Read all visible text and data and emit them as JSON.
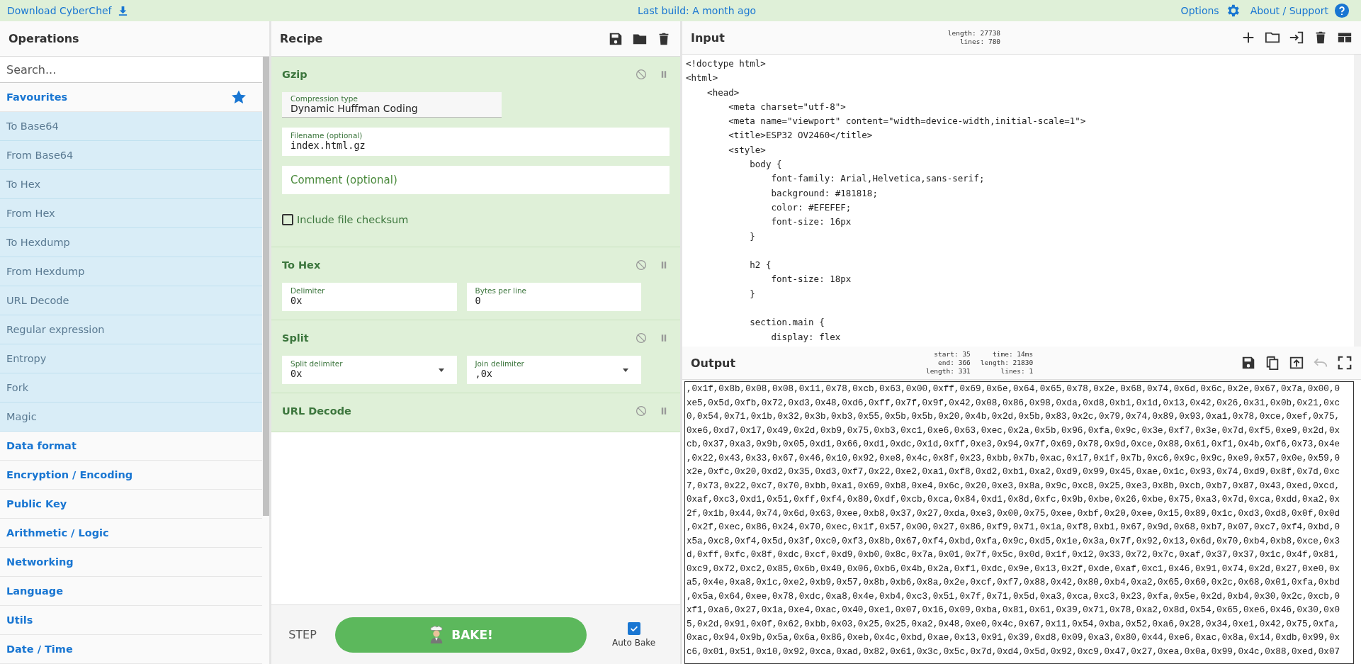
{
  "top_bar": {
    "download_link": "Download CyberChef",
    "build": "Last build: A month ago",
    "options": "Options",
    "about": "About / Support"
  },
  "operations": {
    "title": "Operations",
    "search": {
      "placeholder": "Search..."
    },
    "favourites": "Favourites",
    "items": [
      {
        "label": "To Base64"
      },
      {
        "label": "From Base64"
      },
      {
        "label": "To Hex"
      },
      {
        "label": "From Hex"
      },
      {
        "label": "To Hexdump"
      },
      {
        "label": "From Hexdump"
      },
      {
        "label": "URL Decode"
      },
      {
        "label": "Regular expression"
      },
      {
        "label": "Entropy"
      },
      {
        "label": "Fork"
      },
      {
        "label": "Magic"
      }
    ],
    "categories": [
      "Data format",
      "Encryption / Encoding",
      "Public Key",
      "Arithmetic / Logic",
      "Networking",
      "Language",
      "Utils",
      "Date / Time"
    ]
  },
  "recipe": {
    "title": "Recipe",
    "operations": [
      {
        "name": "Gzip",
        "args": [
          {
            "kind": "option",
            "label": "Compression type",
            "value": "Dynamic Huffman Coding"
          },
          {
            "kind": "text",
            "label": "Filename (optional)",
            "value": "index.html.gz"
          },
          {
            "kind": "empty",
            "placeholder": "Comment (optional)"
          },
          {
            "kind": "checkbox",
            "label": "Include file checksum",
            "checked": false
          }
        ]
      },
      {
        "name": "To Hex",
        "args": [
          {
            "kind": "text",
            "label": "Delimiter",
            "value": "0x"
          },
          {
            "kind": "text",
            "label": "Bytes per line",
            "value": "0"
          }
        ]
      },
      {
        "name": "Split",
        "args": [
          {
            "kind": "select",
            "label": "Split delimiter",
            "value": "0x"
          },
          {
            "kind": "select",
            "label": "Join delimiter",
            "value": ",0x"
          }
        ]
      },
      {
        "name": "URL Decode"
      }
    ],
    "step": "STEP",
    "bake": "BAKE!",
    "auto_bake": {
      "label": "Auto Bake",
      "checked": true
    }
  },
  "input": {
    "title": "Input",
    "stats": [
      {
        "label": "length:",
        "value": "27738"
      },
      {
        "label": "lines:",
        "value": "780"
      }
    ],
    "lines": [
      {
        "text": "<!doctype html>"
      },
      {
        "text": "<html>"
      },
      {
        "text": "    <head>"
      },
      {
        "text": "        <meta charset=\"utf-8\">"
      },
      {
        "text": "        <meta name=\"viewport\" content=\"width=device-width,initial-scale=1\">"
      },
      {
        "text": "        <title>ESP32 OV2460</title>"
      },
      {
        "text": "        <style>"
      },
      {
        "text": "            body {"
      },
      {
        "text": "                font-family: Arial,Helvetica,sans-serif;"
      },
      {
        "text": "                background: #181818;"
      },
      {
        "text": "                color: #EFEFEF;"
      },
      {
        "text": "                font-size: 16px"
      },
      {
        "text": "            }"
      },
      {
        "text": "            h2 {",
        "blank_line_before": true
      },
      {
        "text": "                font-size: 18px"
      },
      {
        "text": "            }"
      },
      {
        "text": "            section.main {",
        "blank_line_before": true
      },
      {
        "text": "                display: flex"
      }
    ]
  },
  "output": {
    "title": "Output",
    "stats": [
      {
        "label": "start:",
        "value": "35"
      },
      {
        "label": "end:",
        "value": "366"
      },
      {
        "label": "length:",
        "value": "331"
      },
      {
        "label": "time:",
        "value": "14ms"
      },
      {
        "label": "length:",
        "value": "21830"
      },
      {
        "label": "lines:",
        "value": "1"
      }
    ],
    "lines": [
      ",0x1f,0x8b,0x08,0x08,0x11,0x78,0xcb,0x63,0x00,0xff,0x69,0x6e,0x64,0x65,0x78,0x2e,0x68,0x74,0x6d,0x6c,0x2e,0x67,0x7a,0x00,0",
      "xe5,0x5d,0xfb,0x72,0xd3,0x48,0xd6,0xff,0x7f,0x9f,0x42,0x08,0x86,0x98,0xda,0xd8,0xb1,0x1d,0x13,0x42,0x26,0x31,0x0b,0x21,0xc",
      "0,0x54,0x71,0x1b,0x32,0x3b,0xb3,0x55,0x5b,0x5b,0x20,0x4b,0x2d,0x5b,0x83,0x2c,0x79,0x74,0x89,0x93,0xa1,0x78,0xce,0xef,0x75,",
      "0xe6,0xd7,0x17,0x49,0x2d,0xb9,0x75,0xb3,0xc1,0xe6,0x63,0xec,0x2a,0x5b,0x96,0xfa,0x9c,0x3e,0xf7,0x3e,0x7d,0xf5,0xe9,0x2d,0x",
      "cb,0x37,0xa3,0x9b,0x05,0xd1,0x66,0xd1,0xdc,0x1d,0xff,0xe3,0x94,0x7f,0x69,0x78,0x9d,0xce,0x88,0x61,0xf1,0x4b,0xf6,0x73,0x4e",
      ",0x22,0x43,0x33,0x67,0x46,0x10,0x92,0xe8,0x4c,0x8f,0x23,0xbb,0x7b,0xac,0x17,0x1f,0x7b,0xc6,0x9c,0x9c,0xe9,0x57,0x0e,0x59,0",
      "x2e,0xfc,0x20,0xd2,0x35,0xd3,0xf7,0x22,0xe2,0xa1,0xf8,0xd2,0xb1,0xa2,0xd9,0x99,0x45,0xae,0x1c,0x93,0x74,0xd9,0x8f,0x7d,0xc",
      "7,0x73,0x22,0xc7,0x70,0xbb,0xa1,0x69,0xb8,0xe4,0x6c,0x20,0xe3,0x8a,0x9c,0xc8,0x25,0xe3,0x8b,0xcb,0xb7,0x87,0x43,0xed,0xcd,",
      "0xaf,0xc3,0xd1,0x51,0xff,0xf4,0x80,0xdf,0xcb,0xca,0x84,0xd1,0x8d,0xfc,0x9b,0xbe,0x26,0xbe,0x75,0xa3,0x7d,0xca,0xdd,0xa2,0x",
      "2f,0x1b,0x44,0x74,0x6d,0x63,0xee,0xb8,0x37,0x27,0xda,0xe3,0x00,0x75,0xee,0xbf,0x20,0xee,0x15,0x89,0x1c,0xd3,0xd8,0x0f,0x0d",
      ",0x2f,0xec,0x86,0x24,0x70,0xec,0x1f,0x57,0x00,0x27,0x86,0xf9,0x71,0x1a,0xf8,0xb1,0x67,0x9d,0x68,0xb7,0x07,0xc7,0xf4,0xbd,0",
      "x5a,0xc8,0xf4,0x5d,0x3f,0xc0,0xf3,0x8b,0x67,0xf4,0xbd,0xfa,0x9c,0xd5,0x1e,0x3a,0x7f,0x92,0x13,0x6d,0x70,0xb4,0xb8,0xce,0x3",
      "d,0xff,0xfc,0x8f,0xdc,0xcf,0xd9,0xb0,0x8c,0x7a,0x01,0x7f,0x5c,0x0d,0x1f,0x12,0x33,0x72,0x7c,0xaf,0x37,0x37,0x1c,0x4f,0x81,",
      "0xc9,0x72,0xc2,0x85,0x6b,0x40,0x06,0xb6,0x4b,0x2a,0xf1,0xdc,0x9e,0x13,0x2f,0xde,0xaf,0xc1,0x46,0x91,0x74,0x2d,0x27,0xe0,0x",
      "a5,0x4e,0xa8,0x1c,0xe2,0xb9,0x57,0x8b,0xb6,0x8a,0x2e,0xcf,0xf7,0x88,0x42,0x80,0xb4,0xa2,0x65,0x60,0x2c,0x68,0x01,0xfa,0xbd",
      ",0x5a,0x64,0xee,0x78,0xdc,0xa8,0x4e,0xb4,0xc3,0x51,0x7f,0x71,0x5d,0xa3,0xca,0xc3,0x23,0xfa,0x5e,0x2d,0xb4,0x30,0x2c,0xcb,0",
      "xf1,0xa6,0x27,0x1a,0xe4,0xac,0x40,0xe1,0x07,0x16,0x09,0xba,0x81,0x61,0x39,0x71,0x78,0xa2,0x8d,0x54,0x65,0xe6,0x46,0x30,0x0",
      "5,0x2d,0x91,0x0f,0x62,0xbb,0x03,0x25,0x25,0xa2,0x48,0xe0,0x4c,0x67,0x11,0x54,0xba,0x52,0xa6,0x28,0x34,0xe1,0x42,0x75,0xfa,",
      "0xac,0x94,0x9b,0x5a,0x6a,0x86,0xeb,0x4c,0xbd,0xae,0x13,0x91,0x39,0xd8,0x09,0xa3,0x80,0x44,0xe6,0xac,0x8a,0x14,0xdb,0x99,0x",
      "c6,0x01,0x51,0x10,0x92,0xca,0xad,0x82,0x61,0x3c,0x5c,0x7d,0xd4,0x5d,0x92,0xc9,0x47,0x27,0xea,0x0a,0x99,0x4c,0x88,0xed,0x07"
    ]
  }
}
